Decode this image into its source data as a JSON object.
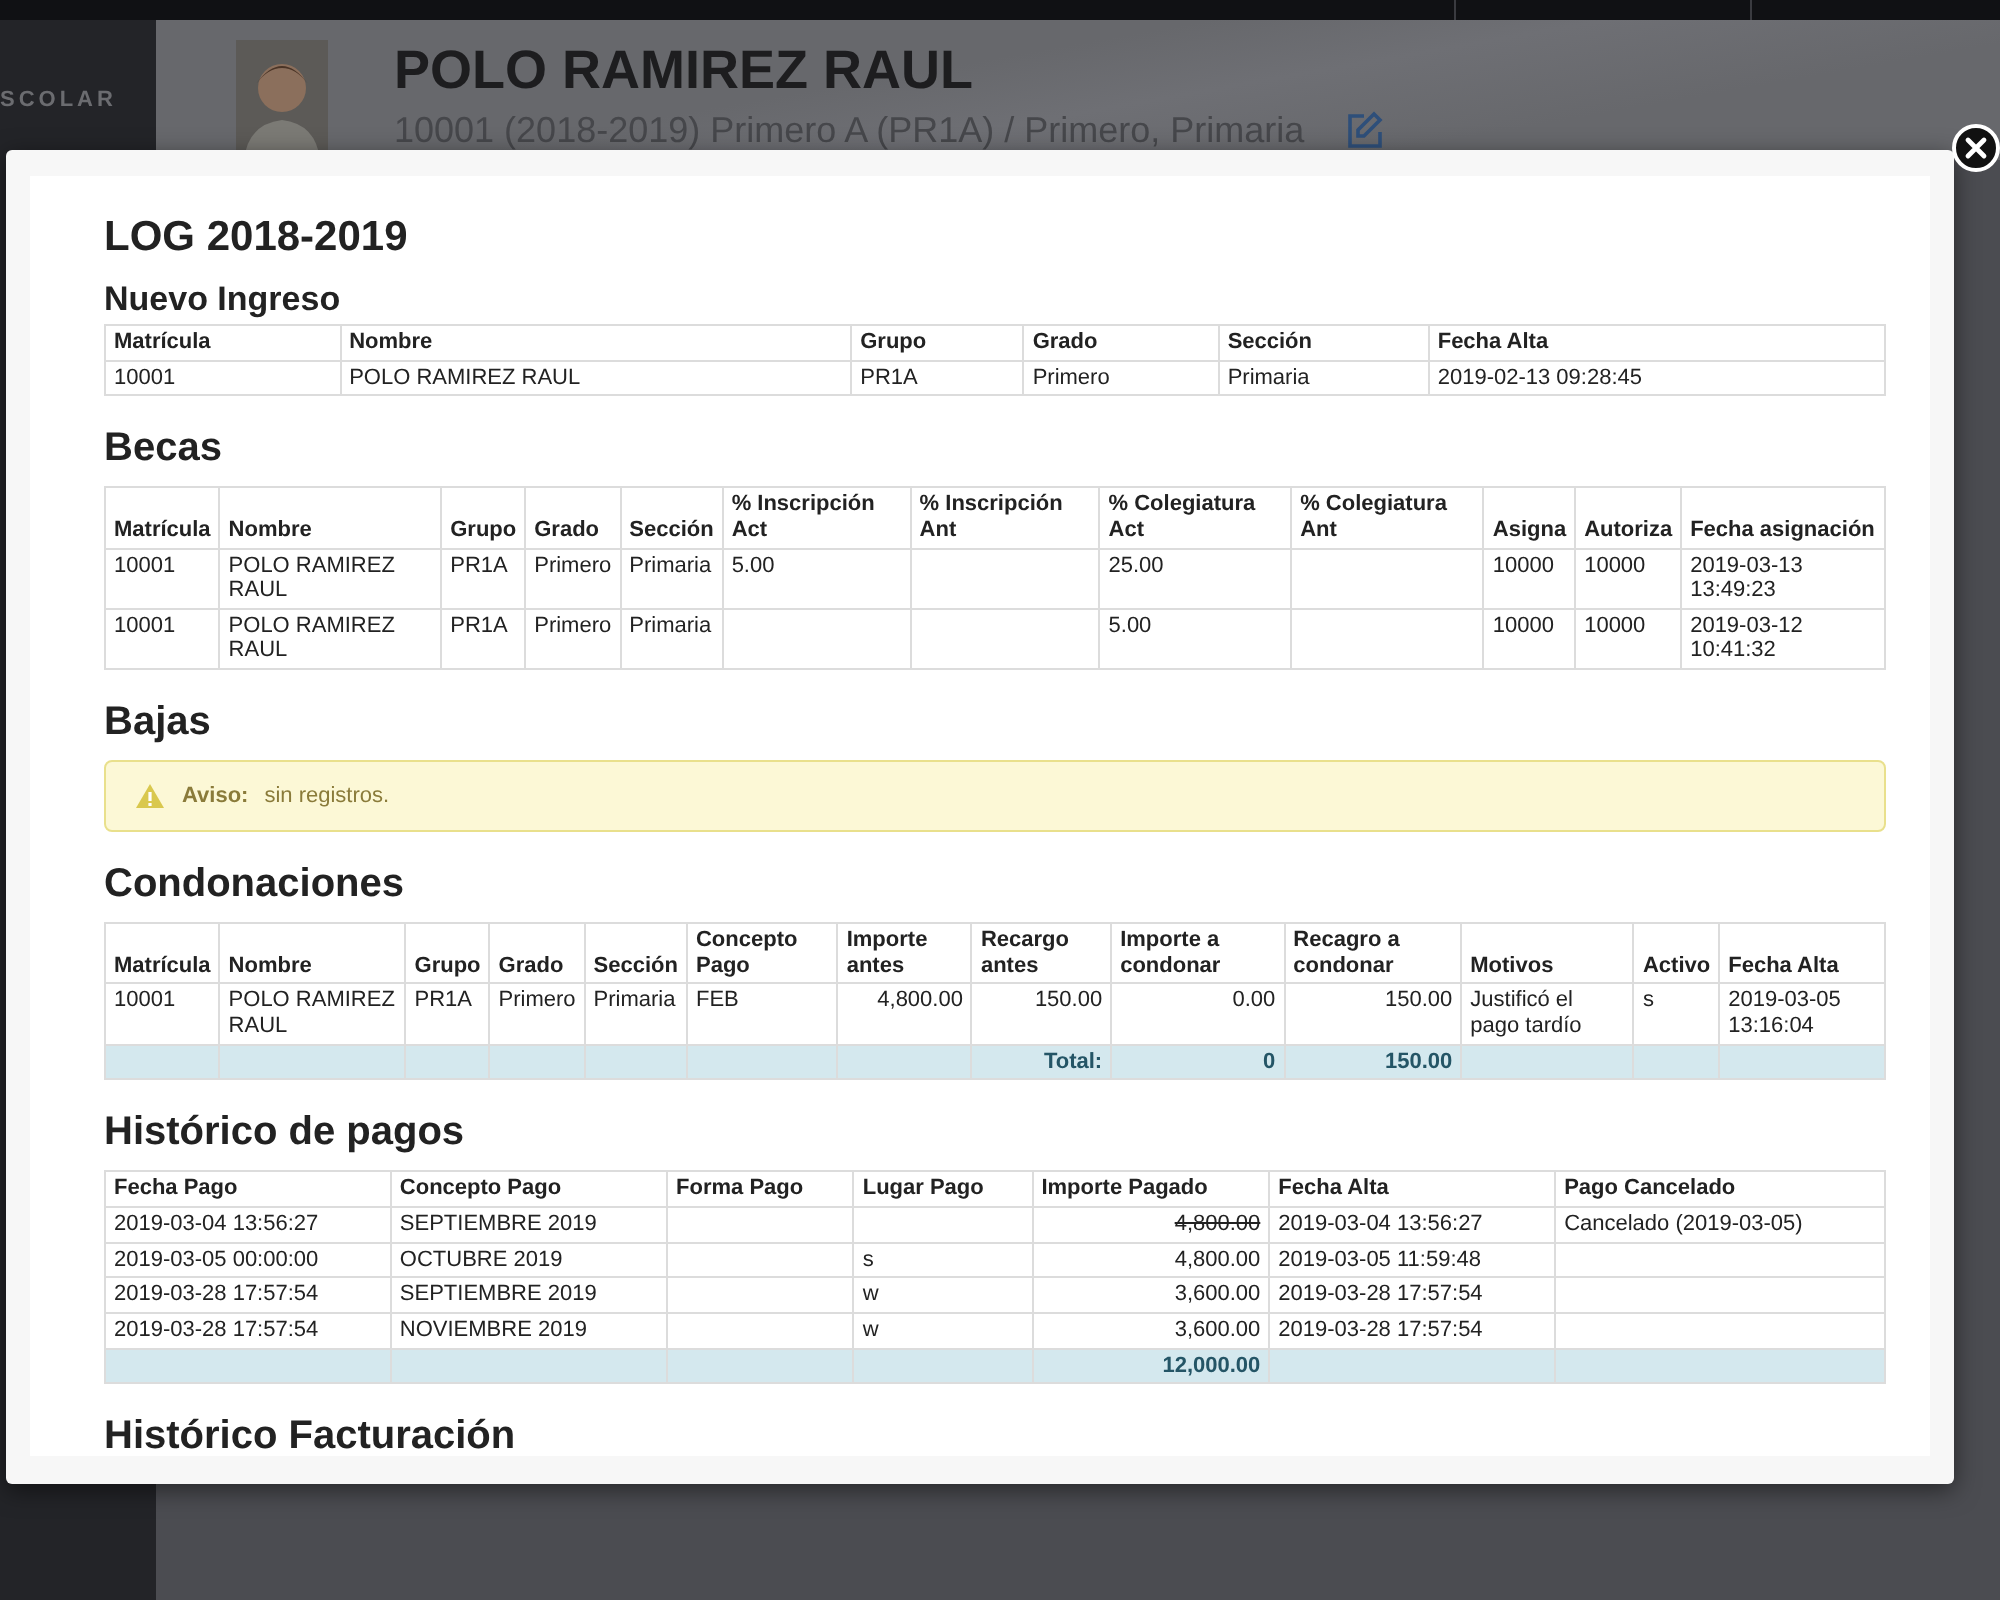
{
  "background": {
    "sidebar_label": "SCOLAR",
    "student_name": "POLO RAMIREZ RAUL",
    "student_info": "10001 (2018-2019) Primero A (PR1A) / Primero, Primaria"
  },
  "modal": {
    "title": "LOG 2018-2019",
    "sections": [
      {
        "kind": "table",
        "title": "Nuevo Ingreso",
        "columns": [
          {
            "label": "Matrícula"
          },
          {
            "label": "Nombre"
          },
          {
            "label": "Grupo"
          },
          {
            "label": "Grado"
          },
          {
            "label": "Sección"
          },
          {
            "label": "Fecha Alta"
          }
        ],
        "rows": [
          {
            "cells": [
              "10001",
              "POLO RAMIREZ RAUL",
              "PR1A",
              "Primero",
              "Primaria",
              "2019-02-13 09:28:45"
            ]
          }
        ]
      },
      {
        "kind": "table",
        "title": "Becas",
        "columns": [
          {
            "label": "Matrícula"
          },
          {
            "label": "Nombre"
          },
          {
            "label": "Grupo"
          },
          {
            "label": "Grado"
          },
          {
            "label": "Sección"
          },
          {
            "label": "% Inscripción Act"
          },
          {
            "label": "% Inscripción Ant"
          },
          {
            "label": "% Colegiatura Act"
          },
          {
            "label": "% Colegiatura Ant"
          },
          {
            "label": "Asigna"
          },
          {
            "label": "Autoriza"
          },
          {
            "label": "Fecha asignación"
          }
        ],
        "rows": [
          {
            "cells": [
              "10001",
              "POLO RAMIREZ RAUL",
              "PR1A",
              "Primero",
              "Primaria",
              "5.00",
              null,
              "25.00",
              null,
              "10000",
              "10000",
              "2019-03-13 13:49:23"
            ]
          },
          {
            "cells": [
              "10001",
              "POLO RAMIREZ RAUL",
              "PR1A",
              "Primero",
              "Primaria",
              null,
              null,
              "5.00",
              null,
              "10000",
              "10000",
              "2019-03-12 10:41:32"
            ]
          }
        ]
      },
      {
        "kind": "alert",
        "title": "Bajas",
        "label": "Aviso:",
        "message": "sin registros."
      },
      {
        "kind": "table",
        "title": "Condonaciones",
        "columns": [
          {
            "label": "Matrícula"
          },
          {
            "label": "Nombre"
          },
          {
            "label": "Grupo"
          },
          {
            "label": "Grado"
          },
          {
            "label": "Sección"
          },
          {
            "label": "Concepto Pago"
          },
          {
            "label": "Importe antes",
            "kind": "amount"
          },
          {
            "label": "Recargo antes",
            "kind": "amount",
            "total": "Total:"
          },
          {
            "label": "Importe a condonar",
            "kind": "amount",
            "total": "0"
          },
          {
            "label": "Recagro a condonar",
            "kind": "amount",
            "total": "150.00"
          },
          {
            "label": "Motivos"
          },
          {
            "label": "Activo"
          },
          {
            "label": "Fecha Alta"
          }
        ],
        "rows": [
          {
            "cells": [
              "10001",
              "POLO RAMIREZ RAUL",
              "PR1A",
              "Primero",
              "Primaria",
              "FEB",
              "4,800.00",
              "150.00",
              "0.00",
              "150.00",
              "Justificó el pago tardío",
              "s",
              "2019-03-05 13:16:04"
            ]
          }
        ],
        "total_row": true
      },
      {
        "kind": "table",
        "title": "Histórico de pagos",
        "columns": [
          {
            "label": "Fecha Pago"
          },
          {
            "label": "Concepto Pago"
          },
          {
            "label": "Forma Pago"
          },
          {
            "label": "Lugar Pago"
          },
          {
            "label": "Importe Pagado",
            "kind": "amount",
            "total": "12,000.00"
          },
          {
            "label": "Fecha Alta"
          },
          {
            "label": "Pago Cancelado"
          }
        ],
        "rows": [
          {
            "cells": [
              "2019-03-04 13:56:27",
              "SEPTIEMBRE 2019",
              null,
              null,
              "4,800.00",
              "2019-03-04 13:56:27",
              "Cancelado (2019-03-05)"
            ],
            "cancelled": true
          },
          {
            "cells": [
              "2019-03-05 00:00:00",
              "OCTUBRE 2019",
              null,
              "s",
              "4,800.00",
              "2019-03-05 11:59:48",
              null
            ],
            "cancelled": false
          },
          {
            "cells": [
              "2019-03-28 17:57:54",
              "SEPTIEMBRE 2019",
              null,
              "w",
              "3,600.00",
              "2019-03-28 17:57:54",
              null
            ],
            "cancelled": false
          },
          {
            "cells": [
              "2019-03-28 17:57:54",
              "NOVIEMBRE 2019",
              null,
              "w",
              "3,600.00",
              "2019-03-28 17:57:54",
              null
            ],
            "cancelled": false
          }
        ],
        "total_row": true
      },
      {
        "kind": "heading",
        "title": "Histórico Facturación"
      }
    ]
  }
}
